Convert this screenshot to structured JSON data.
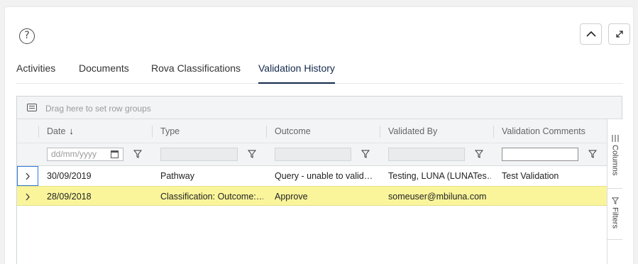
{
  "tabs": [
    "Activities",
    "Documents",
    "Rova Classifications",
    "Validation History"
  ],
  "group_bar": {
    "placeholder": "Drag here to set row groups"
  },
  "columns": [
    {
      "label": "Date",
      "sort": "↓"
    },
    {
      "label": "Type"
    },
    {
      "label": "Outcome"
    },
    {
      "label": "Validated By"
    },
    {
      "label": "Validation Comments"
    }
  ],
  "filters": {
    "date_placeholder": "dd/mm/yyyy"
  },
  "rows": [
    {
      "date": "30/09/2019",
      "type": "Pathway",
      "outcome": "Query - unable to valid…",
      "validated_by": "Testing, LUNA (LUNATes…",
      "comments": "Test Validation"
    },
    {
      "date": "28/09/2018",
      "type": "Classification: Outcome:…",
      "outcome": "Approve",
      "validated_by": "someuser@mbiluna.com",
      "comments": ""
    }
  ],
  "side_panel": {
    "columns_label": "Columns",
    "filters_label": "Filters"
  },
  "colors": {
    "accent": "#13294b",
    "highlight_row": "#faf59b",
    "focus_border": "#2f7bd9"
  },
  "icons": [
    "help-icon",
    "chevron-up-icon",
    "expand-icon",
    "row-group-icon",
    "calendar-icon",
    "filter-icon",
    "chevron-right-icon",
    "columns-icon"
  ]
}
